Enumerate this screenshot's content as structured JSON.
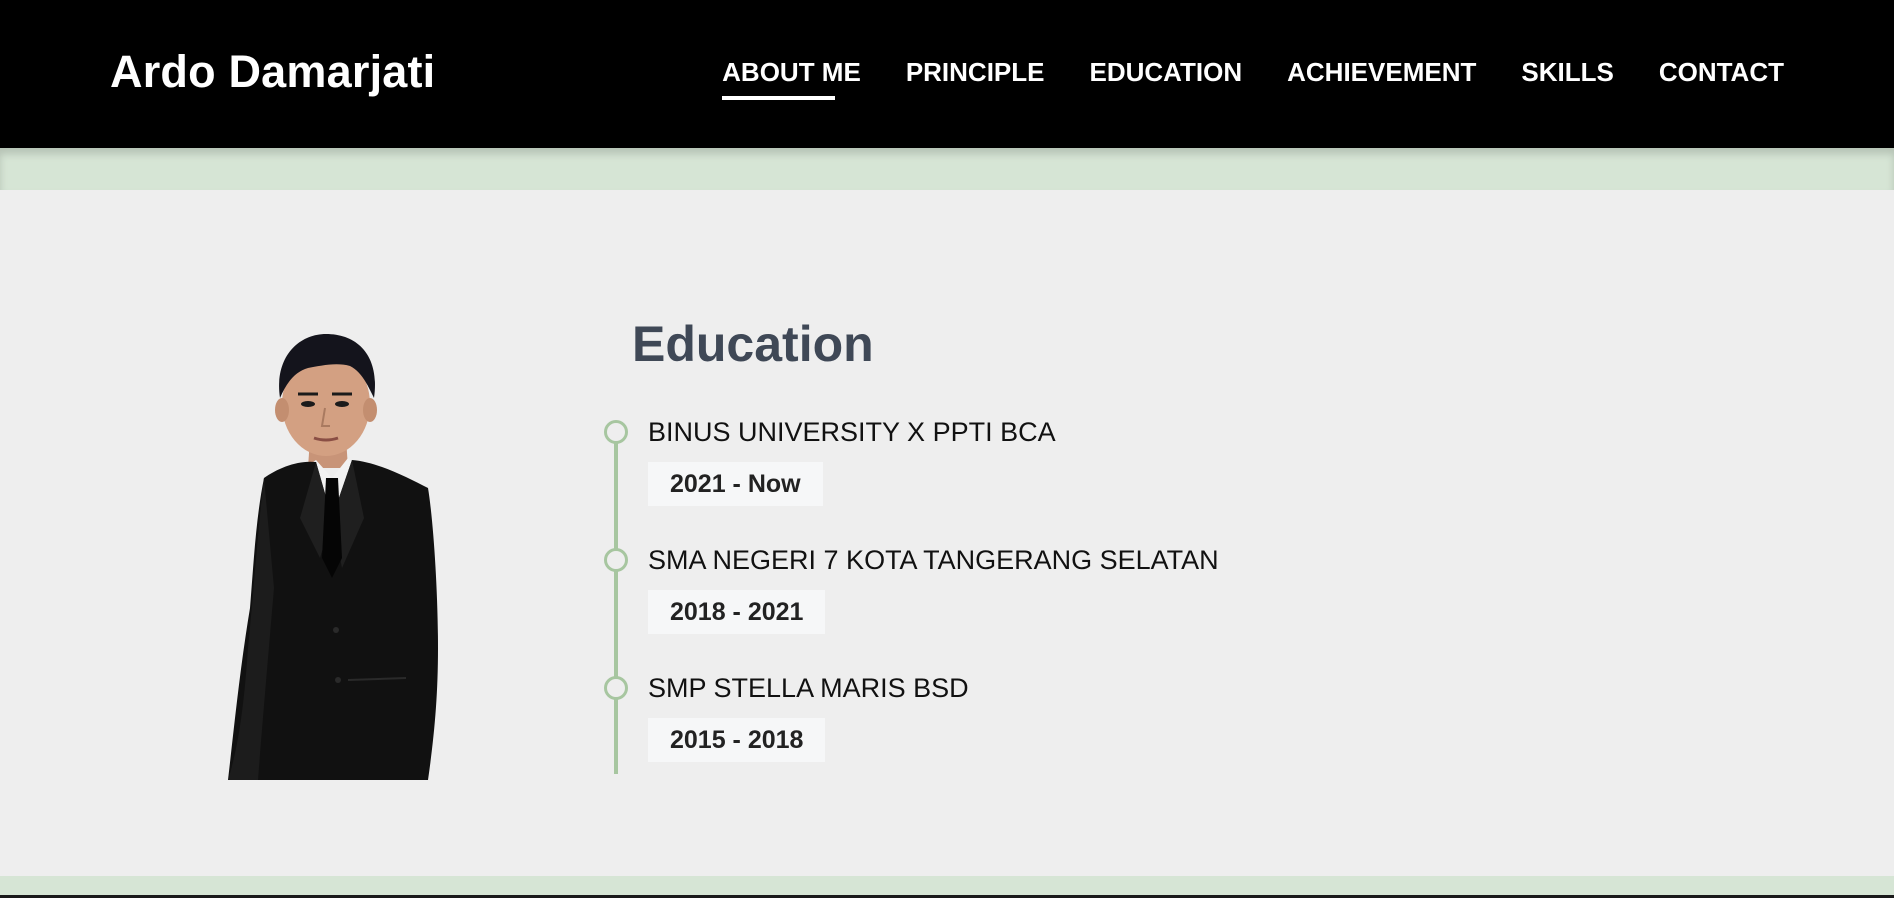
{
  "header": {
    "brand": "Ardo Damarjati",
    "nav": [
      {
        "label": "ABOUT ME",
        "active": true
      },
      {
        "label": "PRINCIPLE",
        "active": false
      },
      {
        "label": "EDUCATION",
        "active": false
      },
      {
        "label": "ACHIEVEMENT",
        "active": false
      },
      {
        "label": "SKILLS",
        "active": false
      },
      {
        "label": "CONTACT",
        "active": false
      }
    ]
  },
  "education": {
    "title": "Education",
    "entries": [
      {
        "school": "BINUS UNIVERSITY X PPTI BCA",
        "years": "2021 - Now"
      },
      {
        "school": "SMA NEGERI 7 KOTA TANGERANG SELATAN",
        "years": "2018 - 2021"
      },
      {
        "school": "SMP STELLA MARIS BSD",
        "years": "2015 - 2018"
      }
    ]
  },
  "colors": {
    "navbar": "#000000",
    "accent_band": "#d6e5d5",
    "timeline": "#a7c6a0",
    "page_bg": "#eeeeee",
    "title": "#3f4856"
  },
  "icons": {
    "timeline_marker": "circle-outline"
  }
}
